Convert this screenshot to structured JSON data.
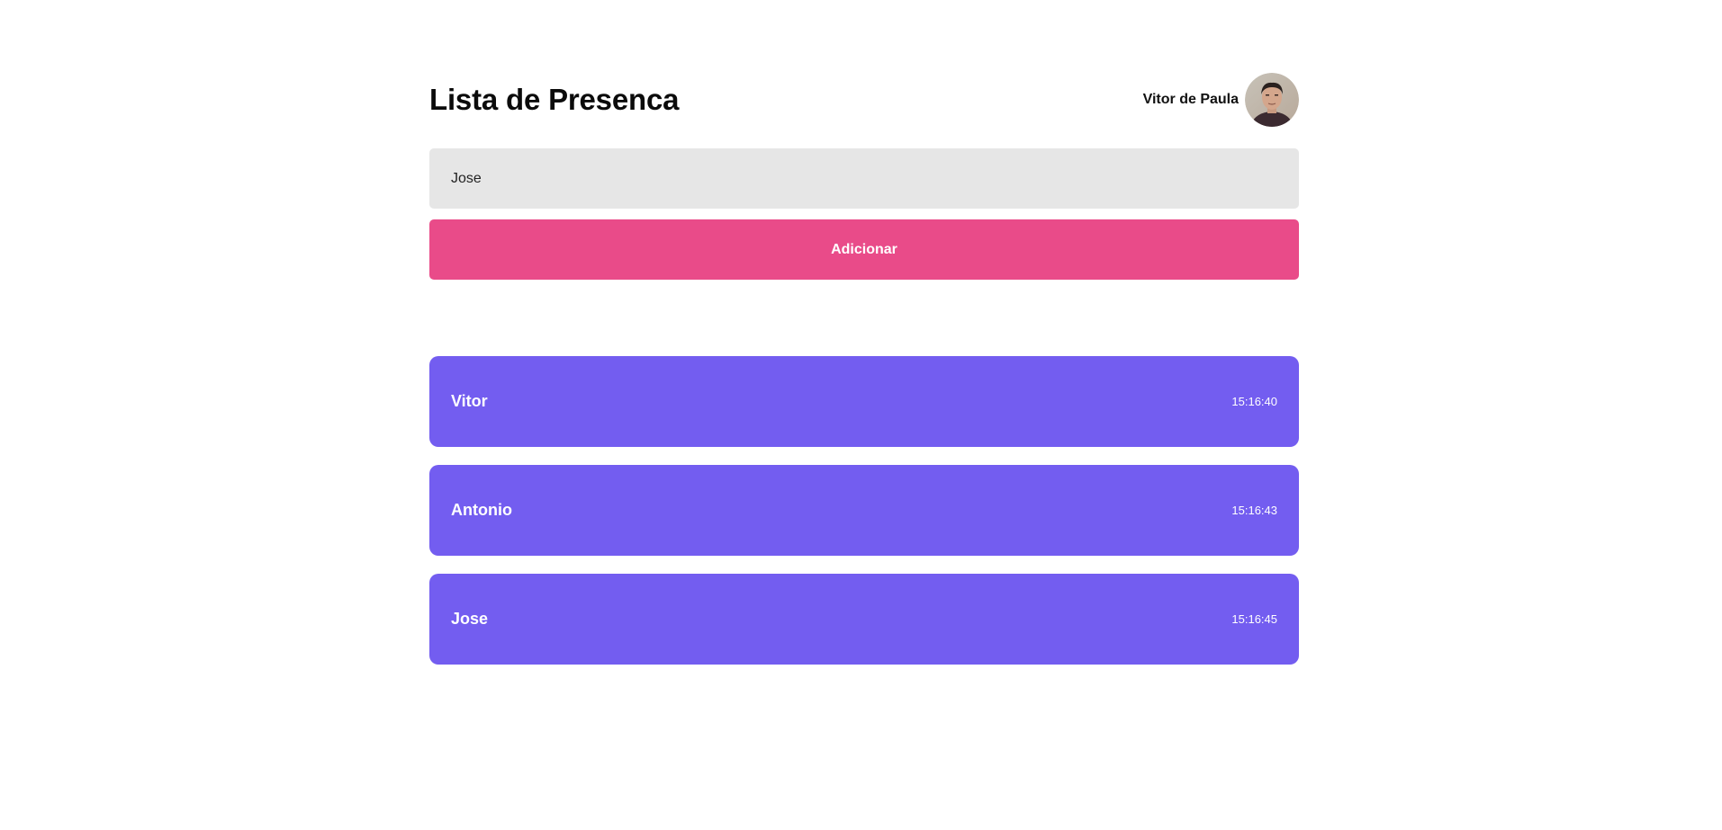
{
  "header": {
    "title": "Lista de Presenca",
    "user_name": "Vitor de Paula"
  },
  "form": {
    "input_value": "Jose",
    "button_label": "Adicionar"
  },
  "attendees": [
    {
      "name": "Vitor",
      "time": "15:16:40"
    },
    {
      "name": "Antonio",
      "time": "15:16:43"
    },
    {
      "name": "Jose",
      "time": "15:16:45"
    }
  ],
  "colors": {
    "button_background": "#e94b89",
    "card_background": "#735df0",
    "input_background": "#e6e6e6"
  }
}
